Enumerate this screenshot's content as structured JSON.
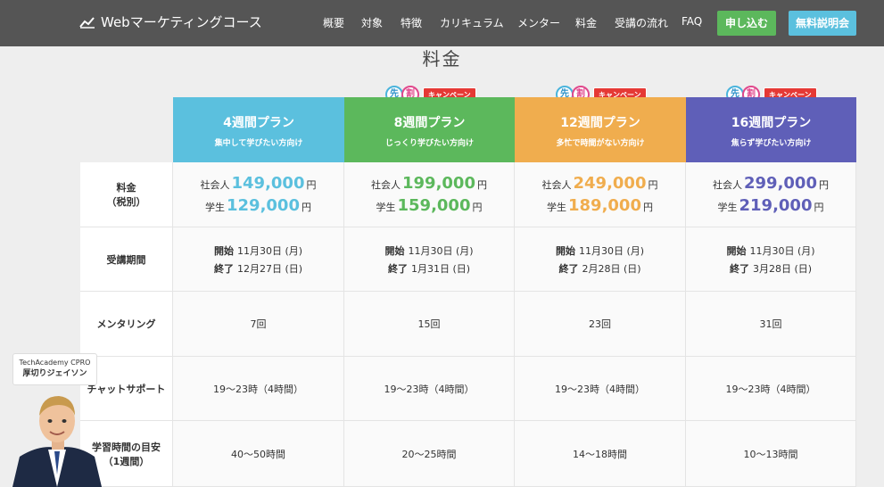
{
  "header": {
    "brand": "Webマーケティングコース",
    "nav": [
      "概要",
      "対象",
      "特徴",
      "カリキュラム",
      "メンター",
      "料金",
      "受講の流れ",
      "FAQ"
    ],
    "apply_label": "申し込む",
    "seminar_label": "無料説明会"
  },
  "section_title": "料金",
  "badge": {
    "first": "先",
    "second": "割",
    "campaign": "キャンペーン"
  },
  "plans": [
    {
      "name": "4週間プラン",
      "sub": "集中して学びたい方向け",
      "color": "#5bc0de",
      "price_worker": "149,000",
      "price_student": "129,000",
      "start": "11月30日 (月)",
      "end": "12月27日 (日)",
      "mentoring": "7回",
      "support": "19〜23時（4時間）",
      "hours": "40〜50時間"
    },
    {
      "name": "8週間プラン",
      "sub": "じっくり学びたい方向け",
      "color": "#5cb85c",
      "price_worker": "199,000",
      "price_student": "159,000",
      "start": "11月30日 (月)",
      "end": "1月31日 (日)",
      "mentoring": "15回",
      "support": "19〜23時（4時間）",
      "hours": "20〜25時間"
    },
    {
      "name": "12週間プラン",
      "sub": "多忙で時間がない方向け",
      "color": "#f0ad4e",
      "price_worker": "249,000",
      "price_student": "189,000",
      "start": "11月30日 (月)",
      "end": "2月28日 (日)",
      "mentoring": "23回",
      "support": "19〜23時（4時間）",
      "hours": "14〜18時間"
    },
    {
      "name": "16週間プラン",
      "sub": "焦らず学びたい方向け",
      "color": "#5f5fb8",
      "price_worker": "299,000",
      "price_student": "219,000",
      "start": "11月30日 (月)",
      "end": "3月28日 (日)",
      "mentoring": "31回",
      "support": "19〜23時（4時間）",
      "hours": "10〜13時間"
    }
  ],
  "labels": {
    "price": "料金",
    "price_note": "（税別）",
    "period": "受講期間",
    "mentoring": "メンタリング",
    "support": "チャットサポート",
    "hours": "学習時間の目安",
    "hours_note": "（1週間）",
    "worker": "社会人",
    "student": "学生",
    "yen": "円",
    "start": "開始",
    "end": "終了"
  },
  "mascot": {
    "line1": "TechAcademy CPRO",
    "line2": "厚切りジェイソン"
  }
}
